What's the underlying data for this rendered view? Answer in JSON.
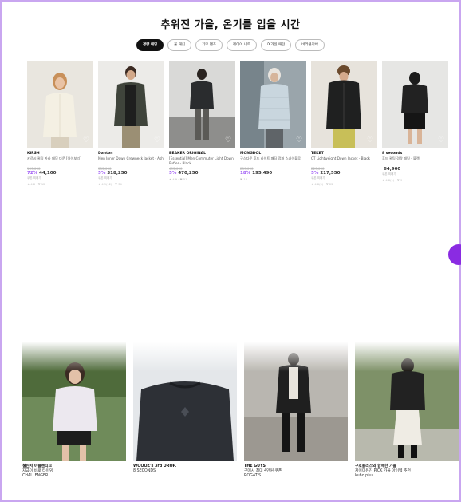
{
  "section_title": "추워진 가을, 온기를 입을 시간",
  "tabs": [
    "경량 패딩",
    "울 재킷",
    "기모 팬츠",
    "레이어 니트",
    "여가일 패턴",
    "바라클라바"
  ],
  "products": [
    {
      "brand": "KIRSH",
      "name": "키르시 퀼팅 카라 패딩 다운 [아이보리]",
      "original": "159,000",
      "discount": "72%",
      "price": "44,100",
      "coupon": "쿠폰 최대가",
      "meta": "★ 4.8 · ♥ 12"
    },
    {
      "brand": "Danton",
      "name": "Men Inner Down Crewneck Jacket - Ash",
      "original": "335,000",
      "discount": "5%",
      "price": "318,250",
      "coupon": "쿠폰 최대가",
      "meta": "★ 4.9(12) · ♥ 34"
    },
    {
      "brand": "BEAKER ORIGINAL",
      "name": "[Essential] Men Commuter Light Down Puffer - Black",
      "original": "495,000",
      "discount": "5%",
      "price": "470,250",
      "coupon": "",
      "meta": "★ 4.9 · ♥ 51"
    },
    {
      "brand": "MONGDOL",
      "name": "구스다운 후드 라이트 패딩 점퍼 스카이블루",
      "original": "239,000",
      "discount": "18%",
      "price": "195,490",
      "coupon": "",
      "meta": "♥ 18"
    },
    {
      "brand": "TEKET",
      "name": "CT Lightweight Down Jacket - Black",
      "original": "229,000",
      "discount": "5%",
      "price": "217,550",
      "coupon": "쿠폰 최대가",
      "meta": "★ 4.8(5) · ♥ 22"
    },
    {
      "brand": "8 seconds",
      "name": "후드 퀼팅 경량 패딩 - 블랙",
      "original": "",
      "discount": "",
      "price": "64,900",
      "coupon": "쿠폰 최대가",
      "meta": "★ 4.8(1) · ♥ 9"
    }
  ],
  "stories": [
    {
      "title": "챌린저 아플렌티크",
      "sub": "지금이 바로 타이밍",
      "brand": "CHALLENGER"
    },
    {
      "title": "WOOOZ's 3rd DROP.",
      "sub": "8 SECONDS",
      "brand": ""
    },
    {
      "title": "THE GUYS",
      "sub": "구매시 최대 4만원 쿠폰",
      "brand": "ROGATIS"
    },
    {
      "title": "구호플러스와 함께한 가을",
      "sub": "제이미유진 PICK 가을 아이템 추천",
      "brand": "kuho plus"
    }
  ],
  "colors": {
    "accent": "#a05bf5",
    "border": "#c9a6f0",
    "fab": "#8a2be2"
  }
}
